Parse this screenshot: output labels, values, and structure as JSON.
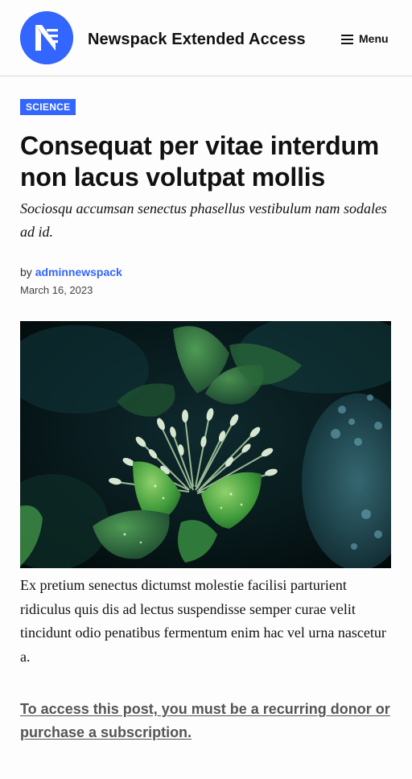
{
  "header": {
    "site_title": "Newspack Extended Access",
    "menu_label": "Menu",
    "logo_icon": "newspack-logo-icon",
    "menu_icon": "hamburger-icon"
  },
  "article": {
    "category": "SCIENCE",
    "title": "Consequat per vitae interdum non lacus volutpat mollis",
    "subtitle": "Sociosqu accumsan senectus phasellus vestibulum nam sodales ad id.",
    "byline_prefix": "by",
    "author": "adminnewspack",
    "date": "March 16, 2023",
    "featured_image": "green plant leaves with flower buds and water droplets",
    "body": "Ex pretium senectus dictumst molestie facilisi parturient ridiculus quis dis ad lectus suspendisse semper curae velit tincidunt odio penatibus fermentum enim hac vel urna nascetur a.",
    "paywall_message": "To access this post, you must be a recurring donor or purchase a subscription."
  },
  "colors": {
    "accent": "#3366ff",
    "text": "#111111",
    "muted": "#555555",
    "background": "#fdfdfd"
  }
}
